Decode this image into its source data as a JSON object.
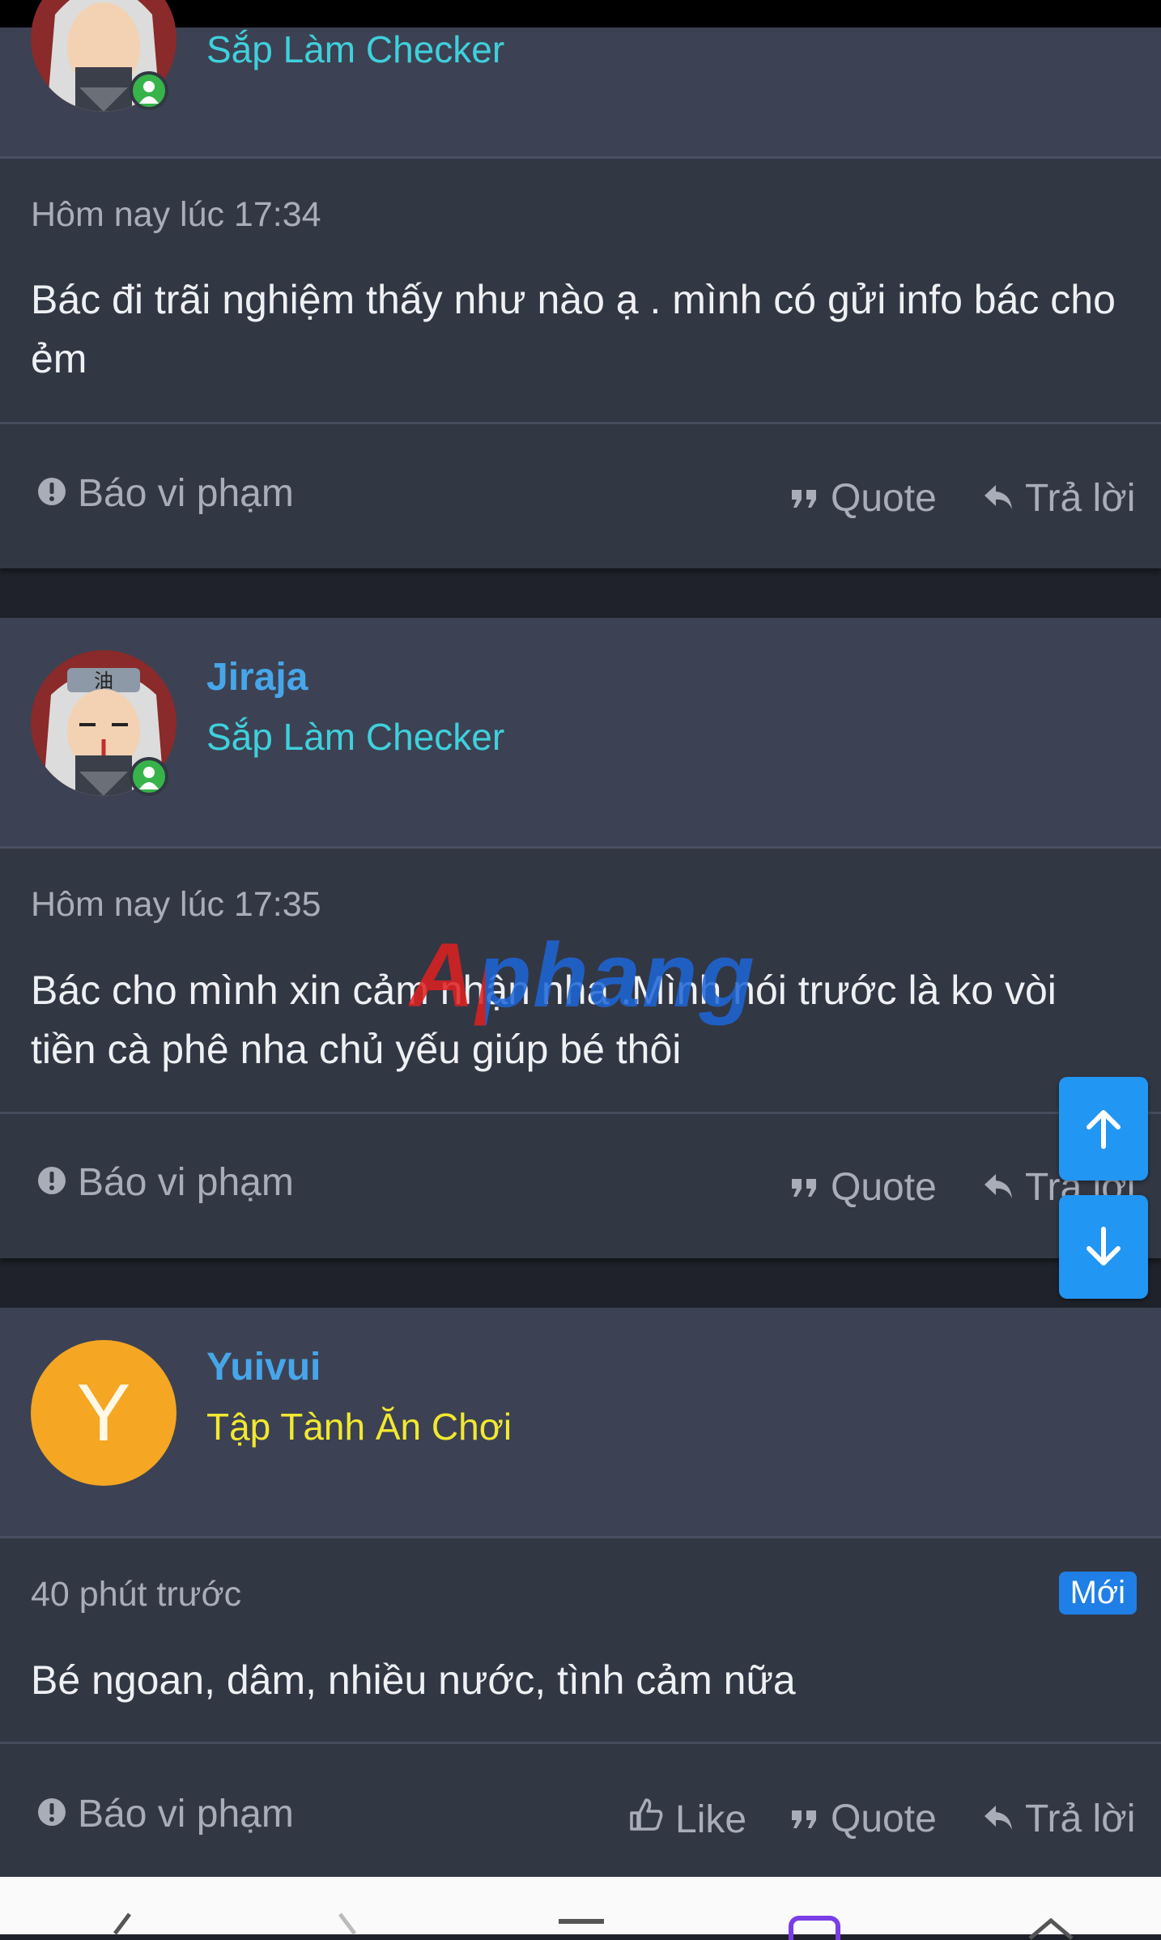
{
  "posts": [
    {
      "username": "",
      "user_title": "Sắp Làm Checker",
      "user_title_color": "#3fd0dc",
      "timestamp": "Hôm nay lúc 17:34",
      "message": "Bác đi trãi nghiệm thấy như nào ạ . mình có gửi info bác cho ẻm",
      "actions": {
        "report": "Báo vi phạm",
        "quote": "Quote",
        "reply": "Trả lời"
      }
    },
    {
      "username": "Jiraja",
      "user_title": "Sắp Làm Checker",
      "user_title_color": "#3fd0dc",
      "timestamp": "Hôm nay lúc 17:35",
      "message": "Bác cho mình xin cảm nhận nha .Mình nói trước là ko vòi tiền cà phê nha chủ yếu giúp bé thôi",
      "actions": {
        "report": "Báo vi phạm",
        "quote": "Quote",
        "reply": "Trả lời"
      }
    },
    {
      "username": "Yuivui",
      "avatar_letter": "Y",
      "avatar_color": "#f5a623",
      "user_title": "Tập Tành Ăn Chơi",
      "user_title_color": "#f2e830",
      "timestamp": "40 phút trước",
      "badge": "Mới",
      "message": "Bé ngoan, dâm, nhiều nước, tình cảm nữa",
      "actions": {
        "report": "Báo vi phạm",
        "like": "Like",
        "quote": "Quote",
        "reply": "Trả lời"
      }
    }
  ],
  "watermark": "Aphang",
  "scroll_buttons": {
    "up": "arrow-up-icon",
    "down": "arrow-down-icon"
  },
  "colors": {
    "accent": "#2196f3",
    "username": "#47a6ea",
    "background": "#323744"
  }
}
